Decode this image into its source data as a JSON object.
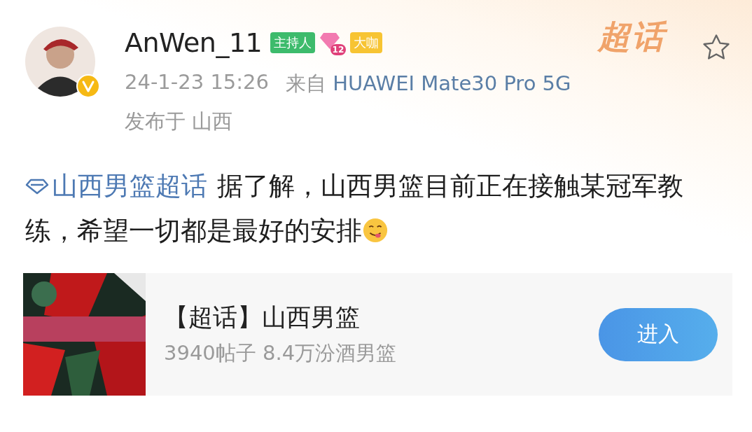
{
  "author": {
    "name": "AnWen_11",
    "verified": true,
    "badges": [
      {
        "kind": "host",
        "label": "主持人"
      },
      {
        "kind": "level",
        "label": "12"
      },
      {
        "kind": "vip",
        "label": "大咖"
      }
    ]
  },
  "topic_logo": "超话",
  "favorited": false,
  "meta": {
    "time": "24-1-23 15:26",
    "source_prefix": "来自",
    "device": "HUAWEI Mate30 Pro 5G",
    "location": "发布于 山西"
  },
  "post": {
    "topic": "山西男篮超话",
    "text": "据了解，山西男篮目前正在接触某冠军教练，希望一切都是最好的安排"
  },
  "card": {
    "title": "【超话】山西男篮",
    "subtitle": "3940帖子 8.4万汾酒男篮",
    "button": "进入"
  }
}
